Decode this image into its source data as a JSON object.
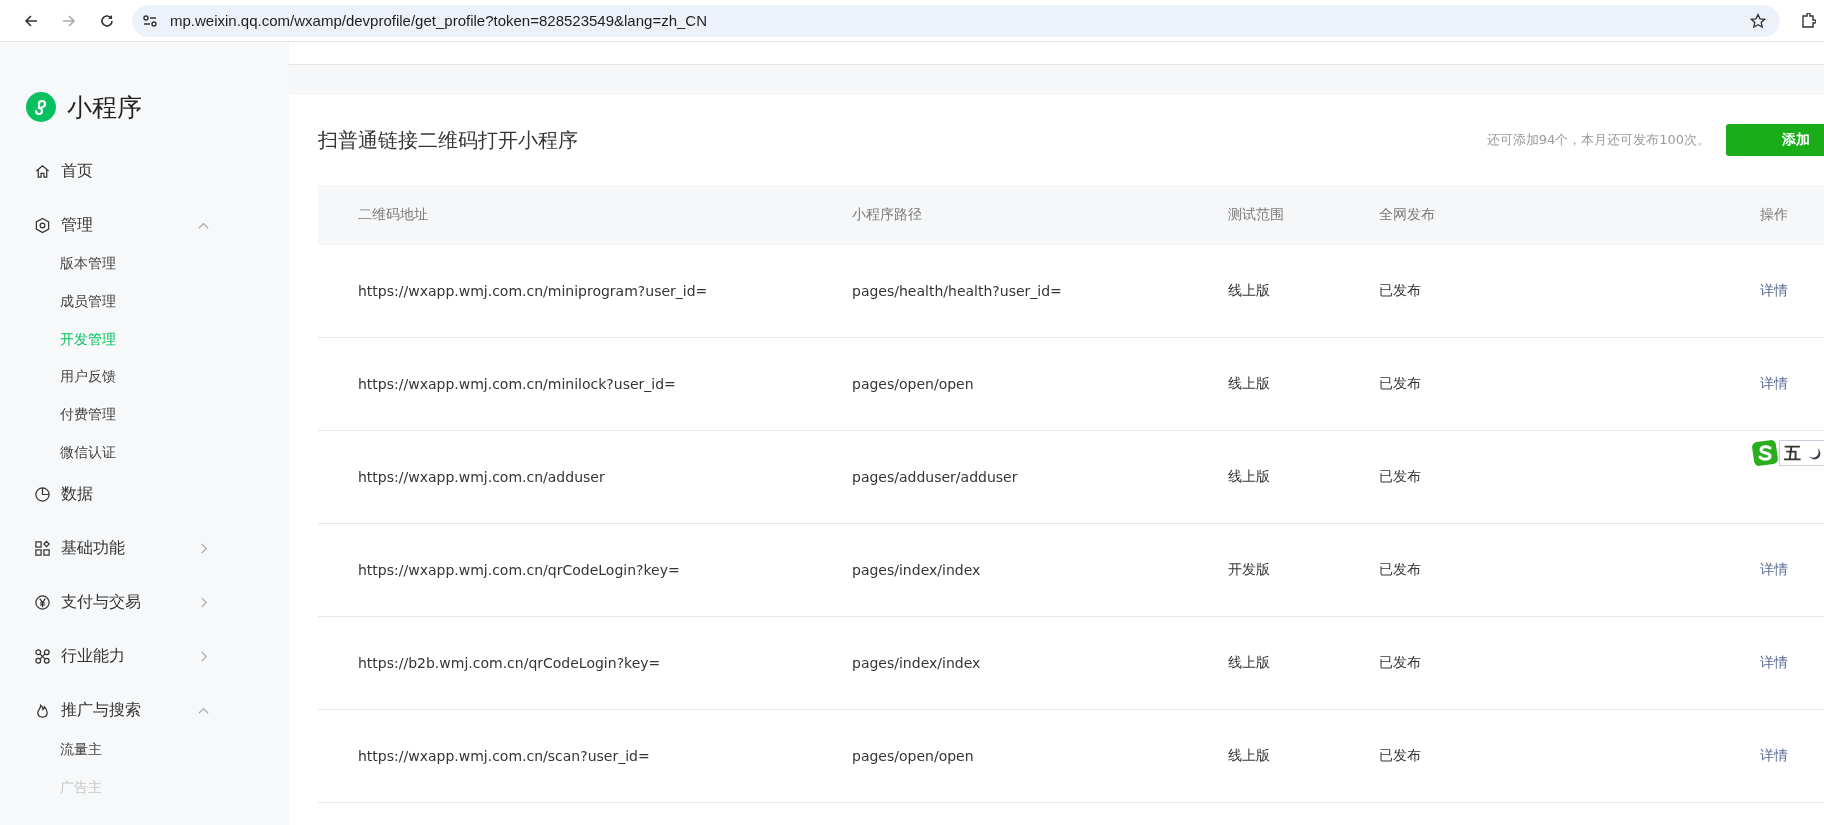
{
  "browser": {
    "url": "mp.weixin.qq.com/wxamp/devprofile/get_profile?token=828523549&lang=zh_CN"
  },
  "sidebar": {
    "logo_text": "小程序",
    "items": [
      {
        "label": "首页",
        "kind": "link",
        "selected": false
      },
      {
        "label": "管理",
        "kind": "group",
        "expanded": true,
        "selected": false,
        "children": [
          {
            "label": "版本管理",
            "selected": false,
            "disabled": false
          },
          {
            "label": "成员管理",
            "selected": false,
            "disabled": false
          },
          {
            "label": "开发管理",
            "selected": true,
            "disabled": false
          },
          {
            "label": "用户反馈",
            "selected": false,
            "disabled": false
          },
          {
            "label": "付费管理",
            "selected": false,
            "disabled": false
          },
          {
            "label": "微信认证",
            "selected": false,
            "disabled": false
          }
        ]
      },
      {
        "label": "数据",
        "kind": "link",
        "selected": false
      },
      {
        "label": "基础功能",
        "kind": "group",
        "expanded": false,
        "selected": false
      },
      {
        "label": "支付与交易",
        "kind": "group",
        "expanded": false,
        "selected": false
      },
      {
        "label": "行业能力",
        "kind": "group",
        "expanded": false,
        "selected": false
      },
      {
        "label": "推广与搜索",
        "kind": "group",
        "expanded": true,
        "selected": false,
        "children": [
          {
            "label": "流量主",
            "selected": false,
            "disabled": false
          },
          {
            "label": "广告主",
            "selected": false,
            "disabled": true
          }
        ]
      }
    ]
  },
  "section": {
    "title": "扫普通链接二维码打开小程序",
    "quota_note": "还可添加94个，本月还可发布100次。",
    "add_button": "添加"
  },
  "table": {
    "columns": [
      "二维码地址",
      "小程序路径",
      "测试范围",
      "全网发布",
      "操作"
    ],
    "rows": [
      {
        "url": "https://wxapp.wmj.com.cn/miniprogram?user_id=",
        "path": "pages/health/health?user_id=",
        "scope": "线上版",
        "publish": "已发布",
        "action": "详情"
      },
      {
        "url": "https://wxapp.wmj.com.cn/minilock?user_id=",
        "path": "pages/open/open",
        "scope": "线上版",
        "publish": "已发布",
        "action": "详情"
      },
      {
        "url": "https://wxapp.wmj.com.cn/adduser",
        "path": "pages/adduser/adduser",
        "scope": "线上版",
        "publish": "已发布"
      },
      {
        "url": "https://wxapp.wmj.com.cn/qrCodeLogin?key=",
        "path": "pages/index/index",
        "scope": "开发版",
        "publish": "已发布",
        "action": "详情"
      },
      {
        "url": "https://b2b.wmj.com.cn/qrCodeLogin?key=",
        "path": "pages/index/index",
        "scope": "线上版",
        "publish": "已发布",
        "action": "详情"
      },
      {
        "url": "https://wxapp.wmj.com.cn/scan?user_id=",
        "path": "pages/open/open",
        "scope": "线上版",
        "publish": "已发布",
        "action": "详情"
      }
    ]
  },
  "ime_toolbar": {
    "mode": "五"
  }
}
